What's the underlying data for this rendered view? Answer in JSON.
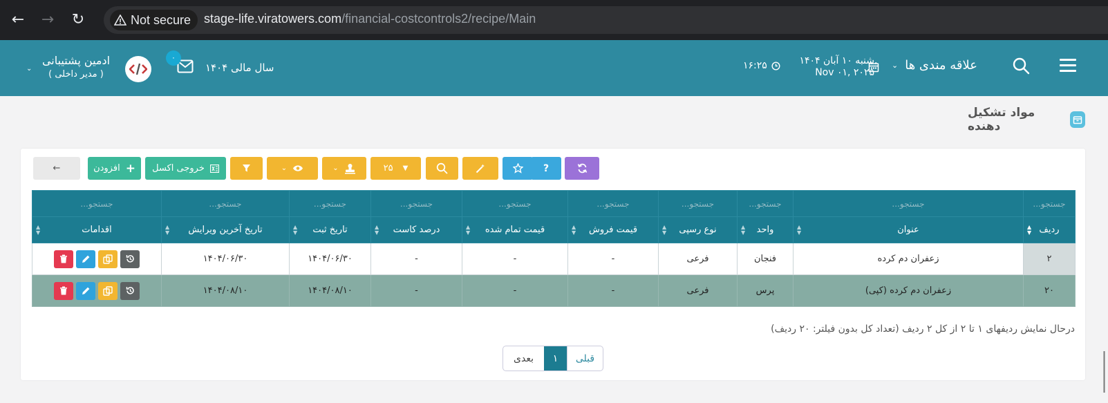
{
  "browser": {
    "back": "←",
    "forward": "→",
    "reload": "↻",
    "security_label": "Not secure",
    "url_host": "stage-life.viratowers.com",
    "url_path": "/financial-costcontrols2/recipe/Main"
  },
  "header": {
    "favorites_label": "علاقه مندی ها",
    "date_fa": "شنبه ۱۰ آبان ۱۴۰۴",
    "date_en": "Nov ۰۱, ۲۰۲۵",
    "time": "۱۶:۲۵",
    "fiscal_year": "سال مالی ۱۴۰۴",
    "notification_count": "۰",
    "user_name": "ادمین پشتیبانی",
    "user_role": "( مدیر داخلی )"
  },
  "page": {
    "title": "مواد تشکیل دهنده"
  },
  "toolbar": {
    "page_size": "۲۵",
    "export_label": "خروجی اکسل",
    "add_label": "افزودن",
    "back_label": "←"
  },
  "table": {
    "search_placeholder": "جستجو...",
    "columns": [
      "ردیف",
      "عنوان",
      "واحد",
      "نوع رسپی",
      "قیمت فروش",
      "قیمت تمام شده",
      "درصد کاست",
      "تاریخ ثبت",
      "تاریخ آخرین ویرایش",
      "اقدامات"
    ],
    "rows": [
      [
        "۲",
        "زعفران دم کرده",
        "فنجان",
        "فرعی",
        "-",
        "-",
        "-",
        "۱۴۰۴/۰۶/۳۰",
        "۱۴۰۴/۰۶/۳۰"
      ],
      [
        "۲۰",
        "زعفران دم کرده (کپی)",
        "پرس",
        "فرعی",
        "-",
        "-",
        "-",
        "۱۴۰۴/۰۸/۱۰",
        "۱۴۰۴/۰۸/۱۰"
      ]
    ]
  },
  "footer": {
    "summary": "درحال نمایش ردیفهای ۱ تا ۲ از کل ۲ ردیف (تعداد کل بدون فیلتر: ۲۰ ردیف)",
    "prev_label": "قبلی",
    "current_page": "۱",
    "next_label": "بعدی"
  },
  "colors": {
    "header_bg": "#2e8aa0",
    "table_header_bg": "#1c7c91",
    "accent_yellow": "#f2b630",
    "accent_green": "#3cb99a",
    "accent_purple": "#9b72d8",
    "accent_blue": "#3aa8dd",
    "danger_red": "#e53950"
  }
}
